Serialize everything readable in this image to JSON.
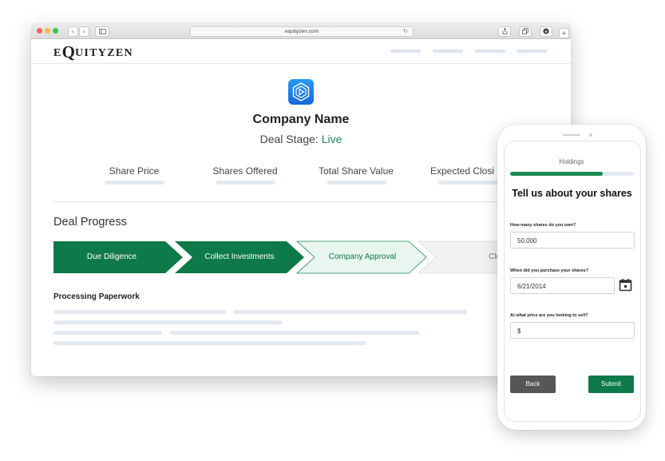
{
  "browser": {
    "url": "equityzen.com",
    "brand_prefix": "E",
    "brand_q": "Q",
    "brand_suffix": "UITYZEN"
  },
  "company": {
    "name": "Company Name",
    "deal_stage_label": "Deal Stage:",
    "deal_stage_value": "Live"
  },
  "stats": [
    "Share Price",
    "Shares Offered",
    "Total Share Value",
    "Expected Closi"
  ],
  "deal_progress": {
    "title": "Deal Progress",
    "steps": [
      {
        "label": "Due Diligence",
        "state": "complete"
      },
      {
        "label": "Collect Investments",
        "state": "complete"
      },
      {
        "label": "Company Approval",
        "state": "current"
      },
      {
        "label": "Closin",
        "state": "upcoming"
      }
    ]
  },
  "paperwork": {
    "title": "Processing Paperwork"
  },
  "colors": {
    "green": "#0e7a49",
    "green_light": "#e9f6ef",
    "gray_step": "#f1f2f3",
    "icon_blue": "#1f7fe8"
  },
  "icons": [
    "company-logo-icon",
    "calendar-icon",
    "reload-icon",
    "share-icon",
    "tabs-icon",
    "download-icon"
  ],
  "phone": {
    "section": "Holdings",
    "progress": 0.75,
    "heading": "Tell us about your shares",
    "q1_label": "How many shares do you own?",
    "q1_value": "50,000",
    "q2_label": "When did you purchase your shares?",
    "q2_value": "6/21/2014",
    "q3_label": "At what price are you looking to sell?",
    "q3_value": "$",
    "back_label": "Back",
    "submit_label": "Submit"
  }
}
